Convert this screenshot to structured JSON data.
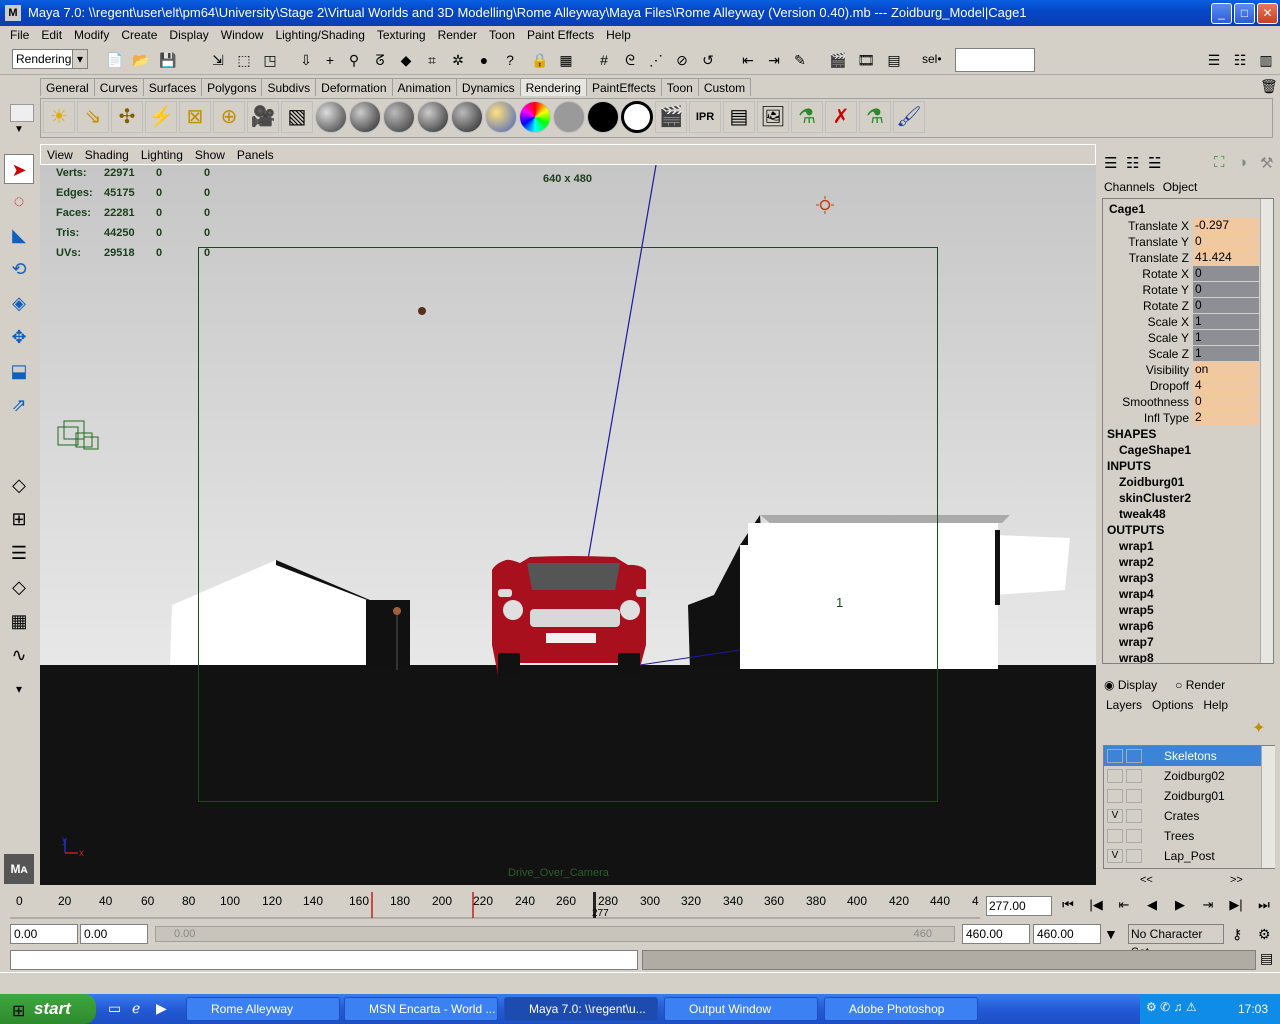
{
  "window": {
    "title": "Maya 7.0: \\\\regent\\user\\elt\\pm64\\University\\Stage 2\\Virtual Worlds and 3D Modelling\\Rome Alleyway\\Maya Files\\Rome Alleyway (Version 0.40).mb   ---   Zoidburg_Model|Cage1",
    "icon": "M",
    "buttons": {
      "minimize": "_",
      "maximize": "□",
      "close": "✕"
    }
  },
  "menubar": [
    "File",
    "Edit",
    "Modify",
    "Create",
    "Display",
    "Window",
    "Lighting/Shading",
    "Texturing",
    "Render",
    "Toon",
    "Paint Effects",
    "Help"
  ],
  "statusline": {
    "mode": "Rendering",
    "sel_label": "sel•",
    "sel_value": ""
  },
  "shelf_tabs": [
    "General",
    "Curves",
    "Surfaces",
    "Polygons",
    "Subdivs",
    "Deformation",
    "Animation",
    "Dynamics",
    "Rendering",
    "PaintEffects",
    "Toon",
    "Custom"
  ],
  "active_shelf": "Rendering",
  "viewport": {
    "menu": [
      "View",
      "Shading",
      "Lighting",
      "Show",
      "Panels"
    ],
    "hud": [
      {
        "label": "Verts:",
        "a": "22971",
        "b": "0",
        "c": "0"
      },
      {
        "label": "Edges:",
        "a": "45175",
        "b": "0",
        "c": "0"
      },
      {
        "label": "Faces:",
        "a": "22281",
        "b": "0",
        "c": "0"
      },
      {
        "label": "Tris:",
        "a": "44250",
        "b": "0",
        "c": "0"
      },
      {
        "label": "UVs:",
        "a": "29518",
        "b": "0",
        "c": "0"
      }
    ],
    "resolution": "640 x 480",
    "camera": "Drive_Over_Camera",
    "marker": "1",
    "axis_x": "x",
    "axis_y": "y"
  },
  "channelbox": {
    "tabs": [
      "Channels",
      "Object"
    ],
    "object": "Cage1",
    "attributes": [
      {
        "label": "Translate X",
        "value": "-0.297",
        "style": "orange"
      },
      {
        "label": "Translate Y",
        "value": "0",
        "style": "orange"
      },
      {
        "label": "Translate Z",
        "value": "41.424",
        "style": "orange"
      },
      {
        "label": "Rotate X",
        "value": "0",
        "style": "gray"
      },
      {
        "label": "Rotate Y",
        "value": "0",
        "style": "gray"
      },
      {
        "label": "Rotate Z",
        "value": "0",
        "style": "gray"
      },
      {
        "label": "Scale X",
        "value": "1",
        "style": "gray"
      },
      {
        "label": "Scale Y",
        "value": "1",
        "style": "gray"
      },
      {
        "label": "Scale Z",
        "value": "1",
        "style": "gray"
      },
      {
        "label": "Visibility",
        "value": "on",
        "style": "orange"
      },
      {
        "label": "Dropoff",
        "value": "4",
        "style": "orange"
      },
      {
        "label": "Smoothness",
        "value": "0",
        "style": "orange"
      },
      {
        "label": "Infl Type",
        "value": "2",
        "style": "orange"
      }
    ],
    "shapes_header": "SHAPES",
    "shapes": [
      "CageShape1"
    ],
    "inputs_header": "INPUTS",
    "inputs": [
      "Zoidburg01",
      "skinCluster2",
      "tweak48"
    ],
    "outputs_header": "OUTPUTS",
    "outputs": [
      "wrap1",
      "wrap2",
      "wrap3",
      "wrap4",
      "wrap5",
      "wrap6",
      "wrap7",
      "wrap8"
    ]
  },
  "layer_editor": {
    "display": "Display",
    "render": "Render",
    "menu": [
      "Layers",
      "Options",
      "Help"
    ],
    "layers": [
      {
        "name": "Skeletons",
        "v": "",
        "selected": true
      },
      {
        "name": "Zoidburg02",
        "v": "",
        "selected": false
      },
      {
        "name": "Zoidburg01",
        "v": "",
        "selected": false
      },
      {
        "name": "Crates",
        "v": "V",
        "selected": false
      },
      {
        "name": "Trees",
        "v": "",
        "selected": false
      },
      {
        "name": "Lap_Post",
        "v": "V",
        "selected": false
      }
    ],
    "nav_left": "<<",
    "nav_right": ">>"
  },
  "timeline": {
    "ticks": [
      "0",
      "20",
      "40",
      "60",
      "80",
      "100",
      "120",
      "140",
      "160",
      "180",
      "200",
      "220",
      "240",
      "260",
      "280",
      "300",
      "320",
      "340",
      "360",
      "380",
      "400",
      "420",
      "440",
      "4"
    ],
    "current_frame": "277.00",
    "current_marker": "277"
  },
  "range": {
    "start": "0.00",
    "inner_start": "0.00",
    "inner_end": "460.00",
    "end": "460.00",
    "slider_end": "460",
    "character_set": "No Character Set"
  },
  "taskbar": {
    "start": "start",
    "items": [
      {
        "label": "Rome Alleyway",
        "active": false
      },
      {
        "label": "MSN Encarta - World ...",
        "active": false
      },
      {
        "label": "Maya 7.0: \\\\regent\\u...",
        "active": true
      },
      {
        "label": "Output Window",
        "active": false
      },
      {
        "label": "Adobe Photoshop",
        "active": false
      }
    ],
    "clock": "17:03"
  }
}
